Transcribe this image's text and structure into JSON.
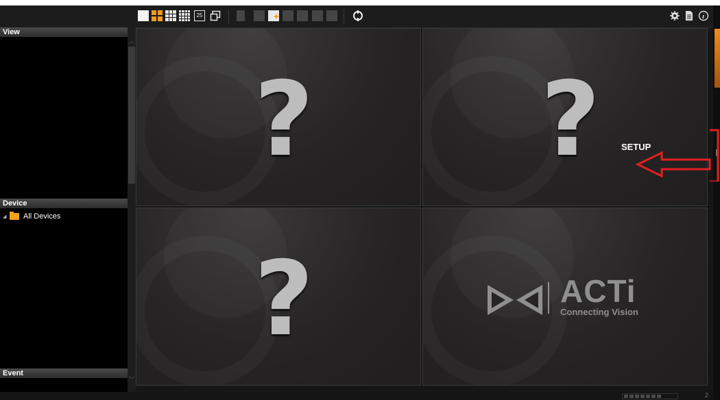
{
  "sidebar": {
    "view_label": "View",
    "device_label": "Device",
    "event_label": "Event",
    "tree": [
      {
        "label": "All Devices",
        "icon": "folder-icon"
      }
    ]
  },
  "toolbar": {
    "layout_25_label": "25",
    "icons": [
      "single-layout-icon",
      "quad-layout-icon",
      "nine-layout-icon",
      "sixteen-layout-icon",
      "twenty-five-layout-icon",
      "window-icon",
      "page-icon",
      "edit-view-icon",
      "add-view-icon",
      "delete-view-icon",
      "rename-view-icon",
      "add-group-icon",
      "edit-group-icon",
      "refresh-icon",
      "setup-gear-icon",
      "document-icon",
      "info-icon"
    ]
  },
  "grid": {
    "cells": [
      {
        "content": "?",
        "kind": "unknown-camera"
      },
      {
        "content": "?",
        "kind": "unknown-camera"
      },
      {
        "content": "?",
        "kind": "unknown-camera"
      },
      {
        "kind": "acti-logo"
      }
    ]
  },
  "logo": {
    "wordmark": "ACTi",
    "tagline": "Connecting Vision"
  },
  "annotation": {
    "label": "SETUP",
    "color": "#e02020"
  },
  "status": {
    "number": "2"
  },
  "colors": {
    "accent": "#f39a1e",
    "background": "#161616"
  }
}
